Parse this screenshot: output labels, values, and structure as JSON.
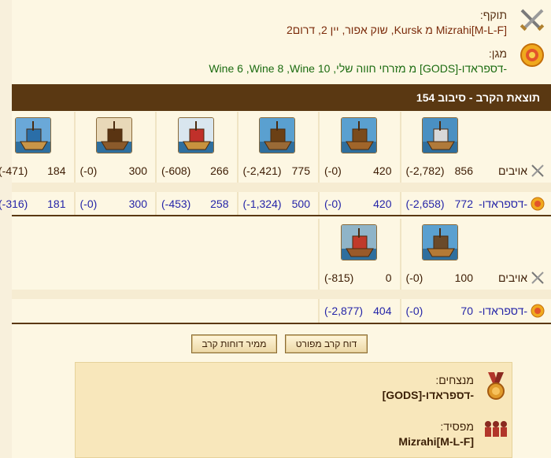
{
  "attacker": {
    "label": "תוקף:",
    "value": "Mizrahi[M-L-F] מ Kursk, שוק אפור, יין 2, דרום2"
  },
  "defender": {
    "label": "מגן:",
    "value": "-דספראדו-[GODS] מ מזרחי חווה שלי, Wine 6 ,Wine 8 ,Wine 10"
  },
  "result_title": "תוצאת הקרב - סיבוב 154",
  "round1": {
    "attacker_label": "אויבים",
    "defender_label": "-דספראדו-",
    "units": [
      {
        "unit": "ship-ram-icon",
        "att": "856",
        "att_loss": "(-2,782)",
        "def": "772",
        "def_loss": "(-2,658)"
      },
      {
        "unit": "ship-catapult-icon",
        "att": "420",
        "att_loss": "(-0)",
        "def": "420",
        "def_loss": "(-0)"
      },
      {
        "unit": "ship-ballista-icon",
        "att": "775",
        "att_loss": "(-2,421)",
        "def": "500",
        "def_loss": "(-1,324)"
      },
      {
        "unit": "ship-mortar-icon",
        "att": "266",
        "att_loss": "(-608)",
        "def": "258",
        "def_loss": "(-453)"
      },
      {
        "unit": "ship-rocket-icon",
        "att": "300",
        "att_loss": "(-0)",
        "def": "300",
        "def_loss": "(-0)"
      },
      {
        "unit": "ship-paddle-icon",
        "att": "184",
        "att_loss": "(-471)",
        "def": "181",
        "def_loss": "(-316)"
      }
    ]
  },
  "round2": {
    "attacker_label": "אויבים",
    "defender_label": "-דספראדו-",
    "units": [
      {
        "unit": "ship-crane-icon",
        "att": "100",
        "att_loss": "(-0)",
        "def": "70",
        "def_loss": "(-0)"
      },
      {
        "unit": "ship-steam-ram-icon",
        "att": "0",
        "att_loss": "(-815)",
        "def": "404",
        "def_loss": "(-2,877)"
      }
    ]
  },
  "buttons": {
    "detailed": "דוח קרב מפורט",
    "sorter": "ממיר דוחות קרב"
  },
  "summary": {
    "winners_label": "מנצחים:",
    "winners_value": "-דספראדו-[GODS]",
    "loser_label": "מפסיד:",
    "loser_value": "Mizrahi[M-L-F]"
  }
}
